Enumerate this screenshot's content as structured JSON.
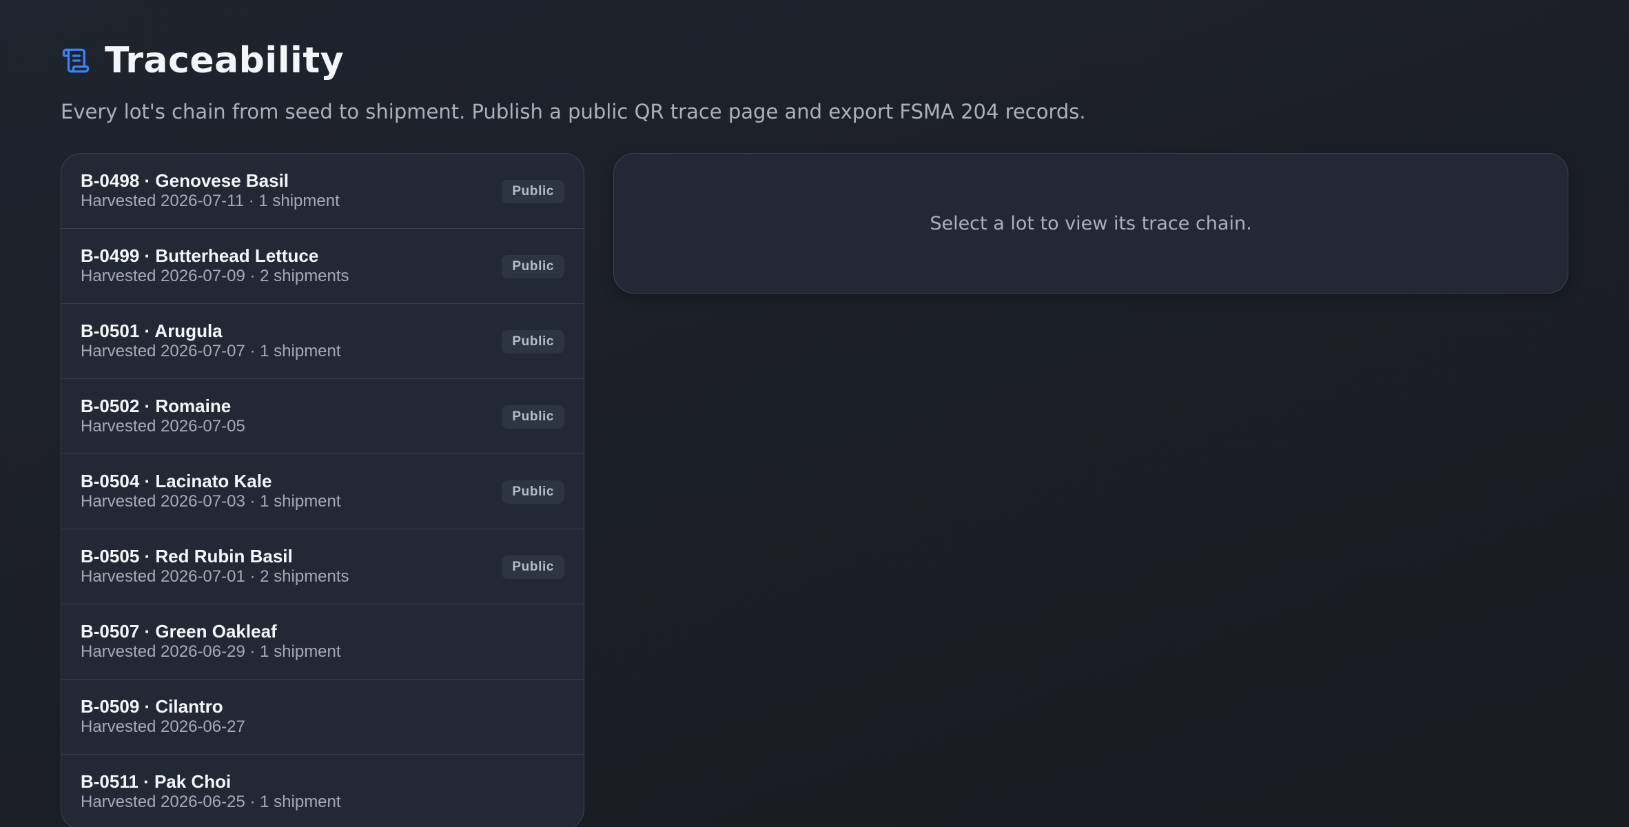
{
  "header": {
    "title": "Traceability",
    "icon": "scroll-icon",
    "icon_color": "#3b82f6",
    "subtitle": "Every lot's chain from seed to shipment. Publish a public QR trace page and export FSMA 204 records."
  },
  "lots": [
    {
      "title": "B-0498 · Genovese Basil",
      "meta": "Harvested 2026-07-11 · 1 shipment",
      "badge": "Public"
    },
    {
      "title": "B-0499 · Butterhead Lettuce",
      "meta": "Harvested 2026-07-09 · 2 shipments",
      "badge": "Public"
    },
    {
      "title": "B-0501 · Arugula",
      "meta": "Harvested 2026-07-07 · 1 shipment",
      "badge": "Public"
    },
    {
      "title": "B-0502 · Romaine",
      "meta": "Harvested 2026-07-05",
      "badge": "Public"
    },
    {
      "title": "B-0504 · Lacinato Kale",
      "meta": "Harvested 2026-07-03 · 1 shipment",
      "badge": "Public"
    },
    {
      "title": "B-0505 · Red Rubin Basil",
      "meta": "Harvested 2026-07-01 · 2 shipments",
      "badge": "Public"
    },
    {
      "title": "B-0507 · Green Oakleaf",
      "meta": "Harvested 2026-06-29 · 1 shipment",
      "badge": ""
    },
    {
      "title": "B-0509 · Cilantro",
      "meta": "Harvested 2026-06-27",
      "badge": ""
    },
    {
      "title": "B-0511 · Pak Choi",
      "meta": "Harvested 2026-06-25 · 1 shipment",
      "badge": ""
    }
  ],
  "detail": {
    "empty_text": "Select a lot to view its trace chain."
  }
}
